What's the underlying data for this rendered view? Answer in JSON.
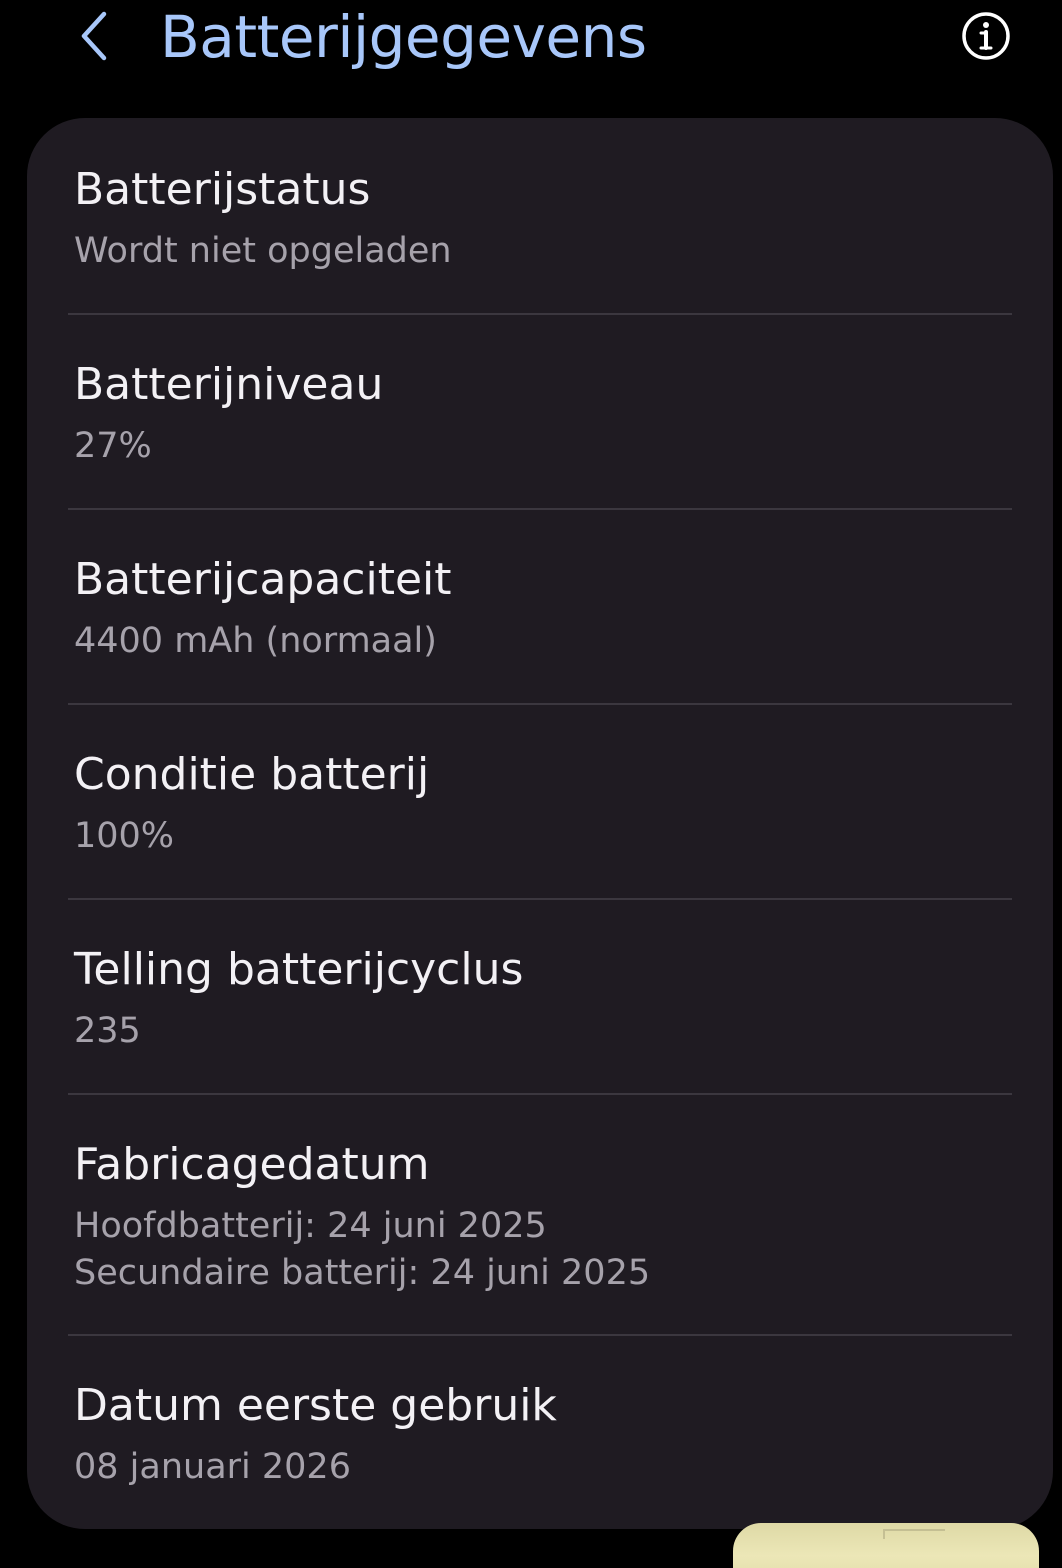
{
  "header": {
    "title": "Batterijgegevens",
    "back_icon": "chevron-left-icon",
    "info_icon": "info-icon"
  },
  "colors": {
    "background": "#000000",
    "card": "#1f1b22",
    "title_accent": "#a8c7fa",
    "primary_text": "#f3f1f5",
    "secondary_text": "#a6a2ab",
    "divider": "#3b373f"
  },
  "rows": [
    {
      "title": "Batterijstatus",
      "value": "Wordt niet opgeladen"
    },
    {
      "title": "Batterijniveau",
      "value": "27%"
    },
    {
      "title": "Batterijcapaciteit",
      "value": "4400 mAh (normaal)"
    },
    {
      "title": "Conditie batterij",
      "value": "100%"
    },
    {
      "title": "Telling batterijcyclus",
      "value": "235"
    },
    {
      "title": "Fabricagedatum",
      "value": "Hoofdbatterij: 24 juni 2025",
      "value2": "Secundaire batterij: 24 juni 2025"
    },
    {
      "title": "Datum eerste gebruik",
      "value": "08 januari 2026"
    }
  ]
}
